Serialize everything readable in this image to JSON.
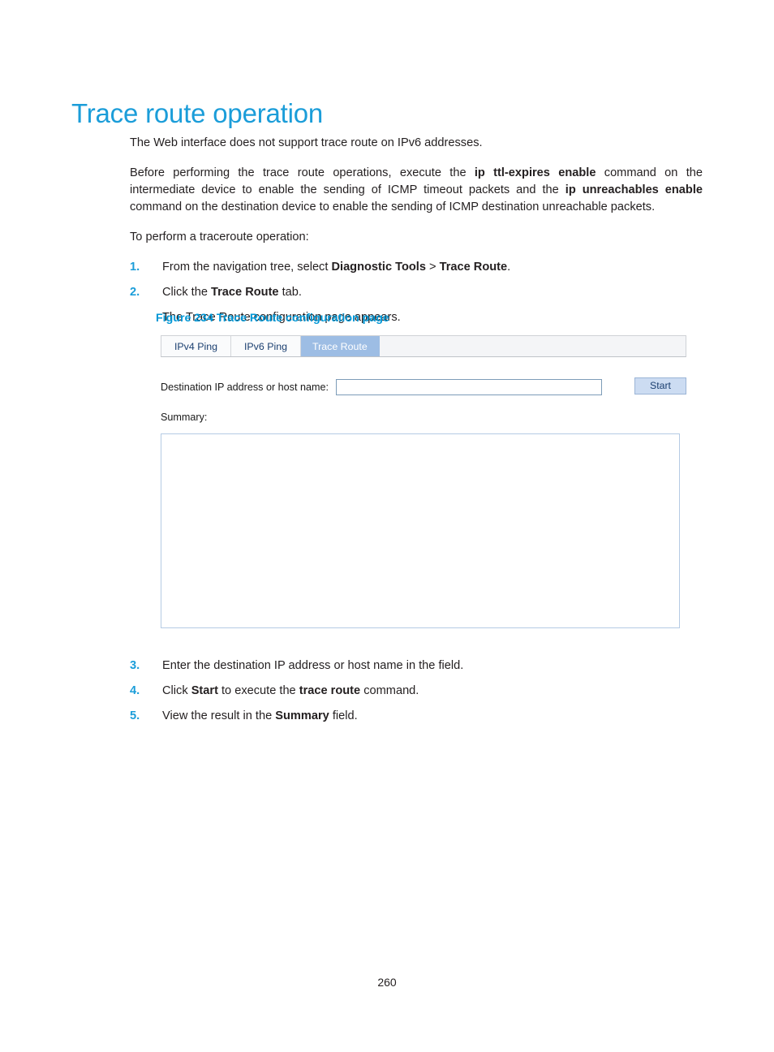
{
  "document": {
    "heading": "Trace route operation",
    "paragraphs": {
      "intro": "The Web interface does not support trace route on IPv6 addresses.",
      "before_1": "Before performing the trace route operations, execute the ",
      "before_bold_1": "ip ttl-expires enable",
      "before_2": " command on the intermediate device to enable the sending of ICMP timeout packets and the ",
      "before_bold_2": "ip unreachables enable",
      "before_3": " command on the destination device to enable the sending of ICMP destination unreachable packets.",
      "to_perform": "To perform a traceroute operation:"
    },
    "steps_top": [
      {
        "num": "1.",
        "text_1": "From the navigation tree, select ",
        "bold_1": "Diagnostic Tools",
        "text_2": " > ",
        "bold_2": "Trace Route",
        "text_3": "."
      },
      {
        "num": "2.",
        "text_1": "Click the ",
        "bold_1": "Trace Route",
        "text_2": " tab.",
        "bold_2": "",
        "text_3": ""
      }
    ],
    "substep": "The Trace Route configuration page appears.",
    "figure_caption": "Figure 234 Trace Route configuration page",
    "steps_bottom": [
      {
        "num": "3.",
        "text_1": "Enter the destination IP address or host name in the field.",
        "bold_1": "",
        "text_2": "",
        "bold_2": "",
        "text_3": ""
      },
      {
        "num": "4.",
        "text_1": "Click ",
        "bold_1": "Start",
        "text_2": " to execute the ",
        "bold_2": "trace route",
        "text_3": " command."
      },
      {
        "num": "5.",
        "text_1": "View the result in the ",
        "bold_1": "Summary",
        "text_2": " field.",
        "bold_2": "",
        "text_3": ""
      }
    ],
    "page_number": "260"
  },
  "figure": {
    "tabs": [
      {
        "label": "IPv4 Ping",
        "active": false
      },
      {
        "label": "IPv6 Ping",
        "active": false
      },
      {
        "label": "Trace Route",
        "active": true
      }
    ],
    "form": {
      "destination_label": "Destination IP address or host name:",
      "destination_value": "",
      "destination_placeholder": "",
      "start_label": "Start",
      "summary_label": "Summary:",
      "summary_value": ""
    }
  },
  "colors": {
    "heading": "#1b9dd9",
    "caption": "#0097d6",
    "list_number": "#1b9dd9",
    "active_tab_bg": "#9dbde4",
    "button_bg": "#ccdcf2",
    "input_border": "#7d9cb8",
    "textarea_border": "#b5cbe4"
  }
}
